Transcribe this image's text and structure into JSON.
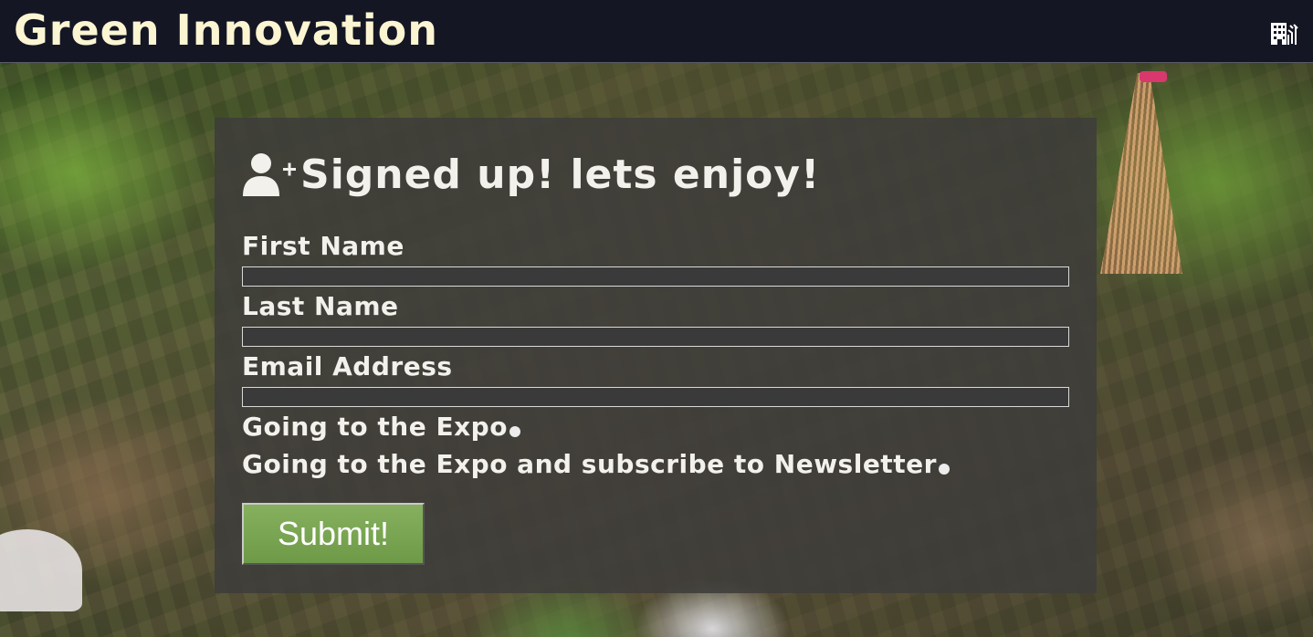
{
  "header": {
    "title": "Green Innovation",
    "right_icon": "building-icon"
  },
  "form": {
    "heading": "Signed up! lets enjoy!",
    "heading_icon": "user-plus-icon",
    "fields": [
      {
        "label": "First Name",
        "value": ""
      },
      {
        "label": "Last Name",
        "value": ""
      },
      {
        "label": "Email Address",
        "value": ""
      }
    ],
    "options": [
      {
        "label": "Going to the Expo",
        "selected": false
      },
      {
        "label": "Going to the Expo and subscribe to Newsletter",
        "selected": false
      }
    ],
    "submit_label": "Submit!"
  },
  "colors": {
    "header_bg": "#141624",
    "title_color": "#fbf5d2",
    "panel_bg": "#3e3c3a",
    "submit_bg": "#7aa652"
  }
}
